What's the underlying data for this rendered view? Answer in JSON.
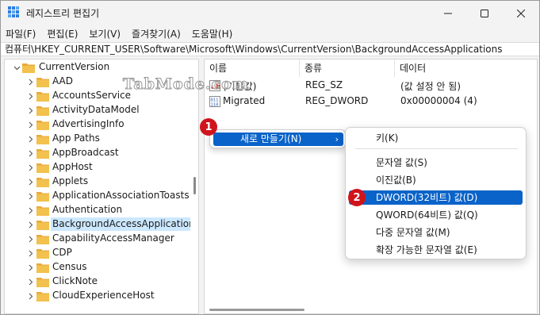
{
  "window": {
    "title": "레지스트리 편집기"
  },
  "menubar": {
    "items": [
      "파일(F)",
      "편집(E)",
      "보기(V)",
      "즐겨찾기(A)",
      "도움말(H)"
    ]
  },
  "address": {
    "path": "컴퓨터\\HKEY_CURRENT_USER\\Software\\Microsoft\\Windows\\CurrentVersion\\BackgroundAccessApplications"
  },
  "tree": {
    "parent": "CurrentVersion",
    "items": [
      "AAD",
      "AccountsService",
      "ActivityDataModel",
      "AdvertisingInfo",
      "App Paths",
      "AppBroadcast",
      "AppHost",
      "Applets",
      "ApplicationAssociationToasts",
      "Authentication",
      "BackgroundAccessApplications",
      "CapabilityAccessManager",
      "CDP",
      "Census",
      "ClickNote",
      "CloudExperienceHost"
    ],
    "selected_index": 10
  },
  "list": {
    "headers": [
      "이름",
      "종류",
      "데이터"
    ],
    "rows": [
      {
        "name": "(기본값)",
        "type": "REG_SZ",
        "data": "(값 설정 안 됨)",
        "icon": "string-value-icon"
      },
      {
        "name": "Migrated",
        "type": "REG_DWORD",
        "data": "0x00000004 (4)",
        "icon": "dword-value-icon"
      }
    ]
  },
  "context_menu": {
    "new_label": "새로 만들기(N)",
    "submenu": {
      "key": "키(K)",
      "string": "문자열 값(S)",
      "binary": "이진값(B)",
      "dword": "DWORD(32비트) 값(D)",
      "qword": "QWORD(64비트) 값(Q)",
      "multi_string": "다중 문자열 값(M)",
      "expandable_string": "확장 가능한 문자열 값(E)"
    }
  },
  "badges": {
    "first": "1",
    "second": "2"
  },
  "watermark": "TabMode.com",
  "colors": {
    "highlight": "#0a63c9",
    "selection": "#cce8ff",
    "badge": "#d0141b",
    "folder": "#f2c14e"
  }
}
